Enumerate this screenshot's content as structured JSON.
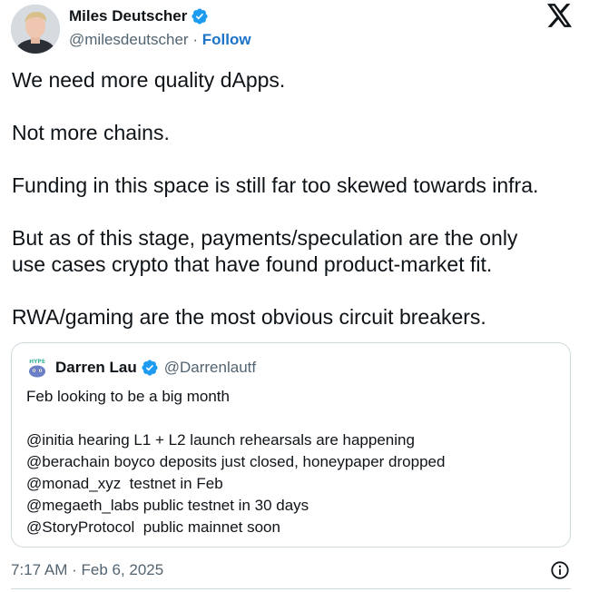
{
  "author": {
    "name": "Miles Deutscher",
    "handle": "@milesdeutscher",
    "separator": "·",
    "follow_label": "Follow",
    "verified_icon": "verified-badge-icon",
    "avatar": "profile-avatar"
  },
  "brand": {
    "logo": "x-logo-icon"
  },
  "tweet": {
    "paragraphs": [
      "We need more quality dApps.",
      "Not more chains.",
      "Funding in this space is still far too skewed towards infra.",
      "But as of this stage, payments/speculation are the only\nuse cases crypto that have found product-market fit.",
      "RWA/gaming are the most obvious circuit breakers."
    ],
    "timestamp": "7:17 AM · Feb 6, 2025",
    "info_icon": "info-icon"
  },
  "quote": {
    "name": "Darren Lau",
    "handle": "@Darrenlautf",
    "avatar_label": "HYPE",
    "lines": [
      "Feb looking to be a big month",
      "",
      "@initia hearing L1 + L2 launch rehearsals are happening",
      "@berachain boyco deposits just closed, honeypaper dropped",
      "@monad_xyz  testnet in Feb",
      "@megaeth_labs public testnet in 30 days",
      "@StoryProtocol  public mainnet soon"
    ]
  },
  "colors": {
    "text": "#0f1419",
    "secondary": "#536471",
    "link": "#1d73c8",
    "verified": "#1d9bf0",
    "border": "#cfd9de"
  }
}
